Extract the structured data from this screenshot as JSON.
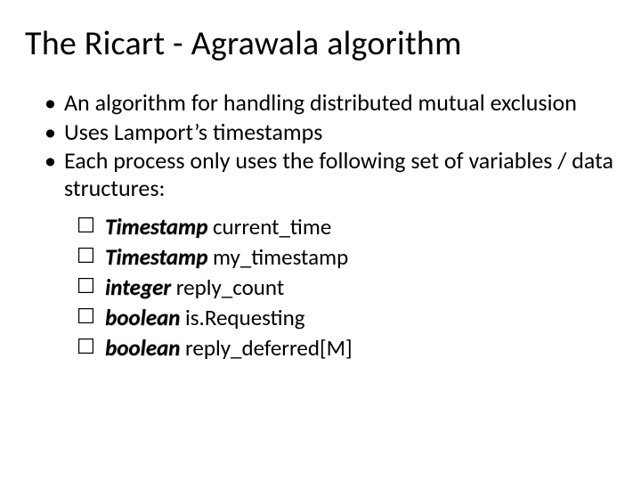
{
  "title": "The Ricart - Agrawala algorithm",
  "bullets": [
    "An algorithm for handling distributed mutual exclusion",
    "Uses Lamport’s timestamps",
    "Each process only uses the following set of variables / data structures:"
  ],
  "vars": [
    {
      "type": "Timestamp",
      "name": "current_time"
    },
    {
      "type": "Timestamp",
      "name": "my_timestamp"
    },
    {
      "type": "integer",
      "name": "reply_count"
    },
    {
      "type": "boolean",
      "name": "is.Requesting"
    },
    {
      "type": "boolean",
      "name": "reply_deferred[M]"
    }
  ]
}
